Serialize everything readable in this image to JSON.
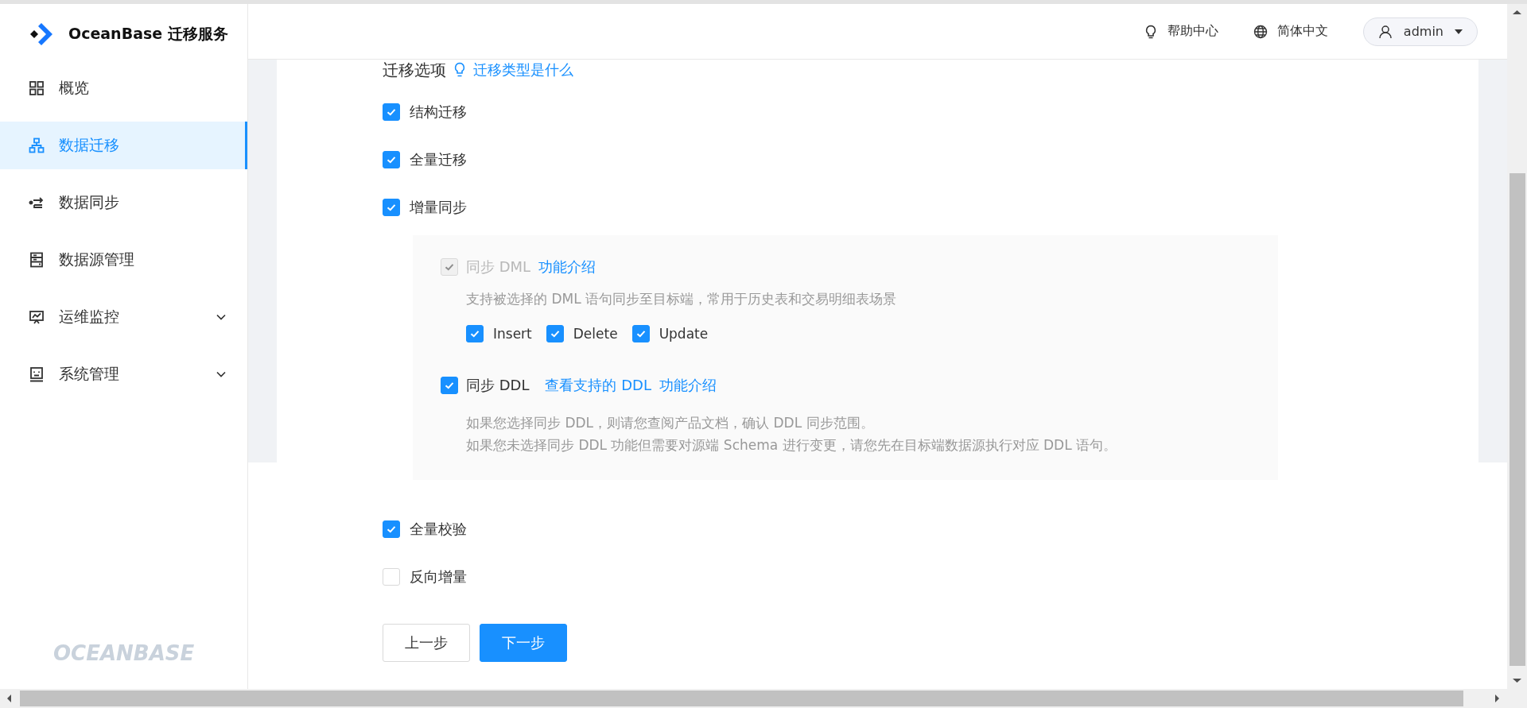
{
  "brand": {
    "name": "OceanBase 迁移服务",
    "footer_logo": "OCEANBASE"
  },
  "header": {
    "links": [
      {
        "label": "帮助中心"
      },
      {
        "label": "简体中文"
      }
    ],
    "user": "admin"
  },
  "sidebar": {
    "items": [
      {
        "label": "概览",
        "kind": "link",
        "selected": false
      },
      {
        "label": "数据迁移",
        "kind": "link",
        "selected": true
      },
      {
        "label": "数据同步",
        "kind": "link",
        "selected": false
      },
      {
        "label": "数据源管理",
        "kind": "link",
        "selected": false
      },
      {
        "label": "运维监控",
        "kind": "submenu",
        "selected": false
      },
      {
        "label": "系统管理",
        "kind": "submenu",
        "selected": false
      }
    ]
  },
  "section": {
    "title": "迁移选项",
    "help_link": "迁移类型是什么"
  },
  "options": [
    {
      "label": "结构迁移",
      "checked": true
    },
    {
      "label": "全量迁移",
      "checked": true
    },
    {
      "label": "增量同步",
      "checked": true,
      "settings": {
        "dml": {
          "label": "同步 DML",
          "link": "功能介绍",
          "checked": true,
          "disabled": true,
          "description": "支持被选择的 DML 语句同步至目标端，常用于历史表和交易明细表场景",
          "operations": [
            {
              "label": "Insert",
              "checked": true
            },
            {
              "label": "Delete",
              "checked": true
            },
            {
              "label": "Update",
              "checked": true
            }
          ]
        },
        "ddl": {
          "label": "同步 DDL",
          "links": [
            "查看支持的 DDL",
            "功能介绍"
          ],
          "checked": true,
          "disabled": false,
          "description_lines": [
            "如果您选择同步 DDL，则请您查阅产品文档，确认 DDL 同步范围。",
            "如果您未选择同步 DDL 功能但需要对源端 Schema 进行变更，请您先在目标端数据源执行对应 DDL 语句。"
          ]
        }
      }
    },
    {
      "label": "全量校验",
      "checked": true
    },
    {
      "label": "反向增量",
      "checked": false
    }
  ],
  "buttons": [
    {
      "label": "上一步",
      "kind": "default"
    },
    {
      "label": "下一步",
      "kind": "primary"
    }
  ]
}
